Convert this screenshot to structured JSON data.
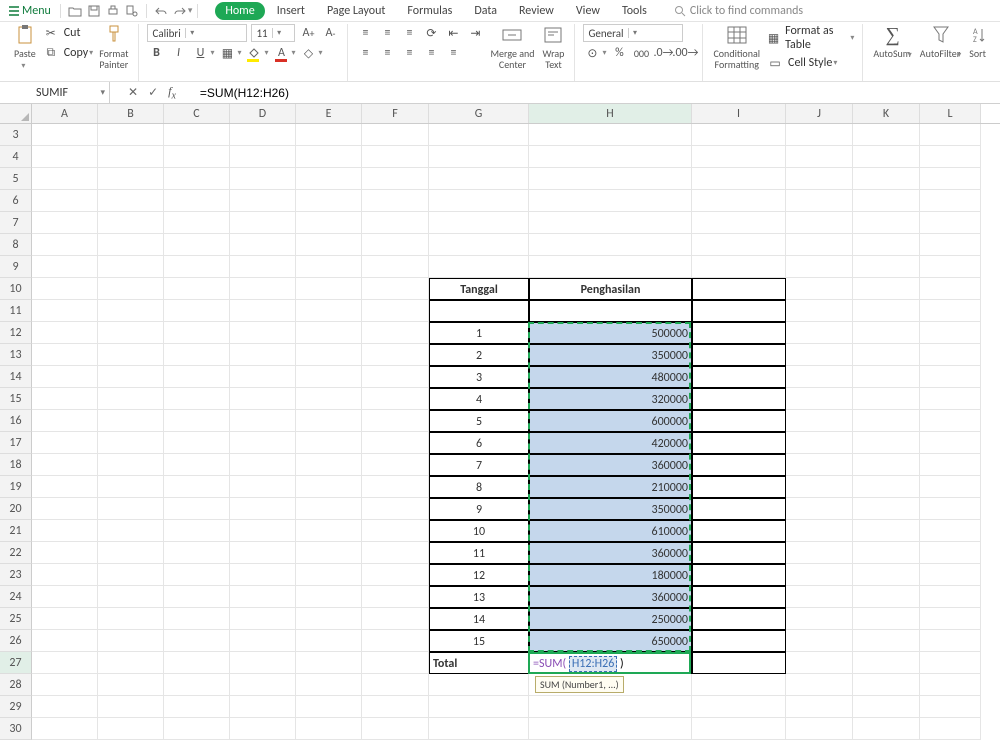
{
  "menubar": {
    "menu_label": "Menu",
    "tabs": [
      "Home",
      "Insert",
      "Page Layout",
      "Formulas",
      "Data",
      "Review",
      "View",
      "Tools"
    ],
    "active_tab": 0,
    "search_placeholder": "Click to find commands"
  },
  "ribbon": {
    "paste": "Paste",
    "cut": "Cut",
    "copy": "Copy",
    "format_painter": "Format\nPainter",
    "font_name": "Calibri",
    "font_size": "11",
    "number_format": "General",
    "merge_center": "Merge and\nCenter",
    "wrap_text": "Wrap\nText",
    "conditional_formatting": "Conditional\nFormatting",
    "format_table": "Format as Table",
    "cell_style": "Cell Style",
    "autosum": "AutoSum",
    "autofilter": "AutoFilter",
    "sort": "Sort"
  },
  "formula_bar": {
    "name_box": "SUMIF",
    "formula": "=SUM(H12:H26)"
  },
  "columns": [
    "A",
    "B",
    "C",
    "D",
    "E",
    "F",
    "G",
    "H",
    "I",
    "J",
    "K",
    "L"
  ],
  "first_row": 3,
  "last_row": 30,
  "active_col": "H",
  "active_row": 27,
  "table": {
    "header_row": 10,
    "g_header": "Tanggal",
    "h_header": "Penghasilan",
    "data": [
      {
        "tanggal": "1",
        "penghasilan": "500000"
      },
      {
        "tanggal": "2",
        "penghasilan": "350000"
      },
      {
        "tanggal": "3",
        "penghasilan": "480000"
      },
      {
        "tanggal": "4",
        "penghasilan": "320000"
      },
      {
        "tanggal": "5",
        "penghasilan": "600000"
      },
      {
        "tanggal": "6",
        "penghasilan": "420000"
      },
      {
        "tanggal": "7",
        "penghasilan": "360000"
      },
      {
        "tanggal": "8",
        "penghasilan": "210000"
      },
      {
        "tanggal": "9",
        "penghasilan": "350000"
      },
      {
        "tanggal": "10",
        "penghasilan": "610000"
      },
      {
        "tanggal": "11",
        "penghasilan": "360000"
      },
      {
        "tanggal": "12",
        "penghasilan": "180000"
      },
      {
        "tanggal": "13",
        "penghasilan": "360000"
      },
      {
        "tanggal": "14",
        "penghasilan": "250000"
      },
      {
        "tanggal": "15",
        "penghasilan": "650000"
      }
    ],
    "total_label": "Total",
    "editing_formula_fn": "=SUM(",
    "editing_formula_ref": "H12:H26",
    "editing_formula_close": ")"
  },
  "tooltip": "SUM (Number1, ...)"
}
